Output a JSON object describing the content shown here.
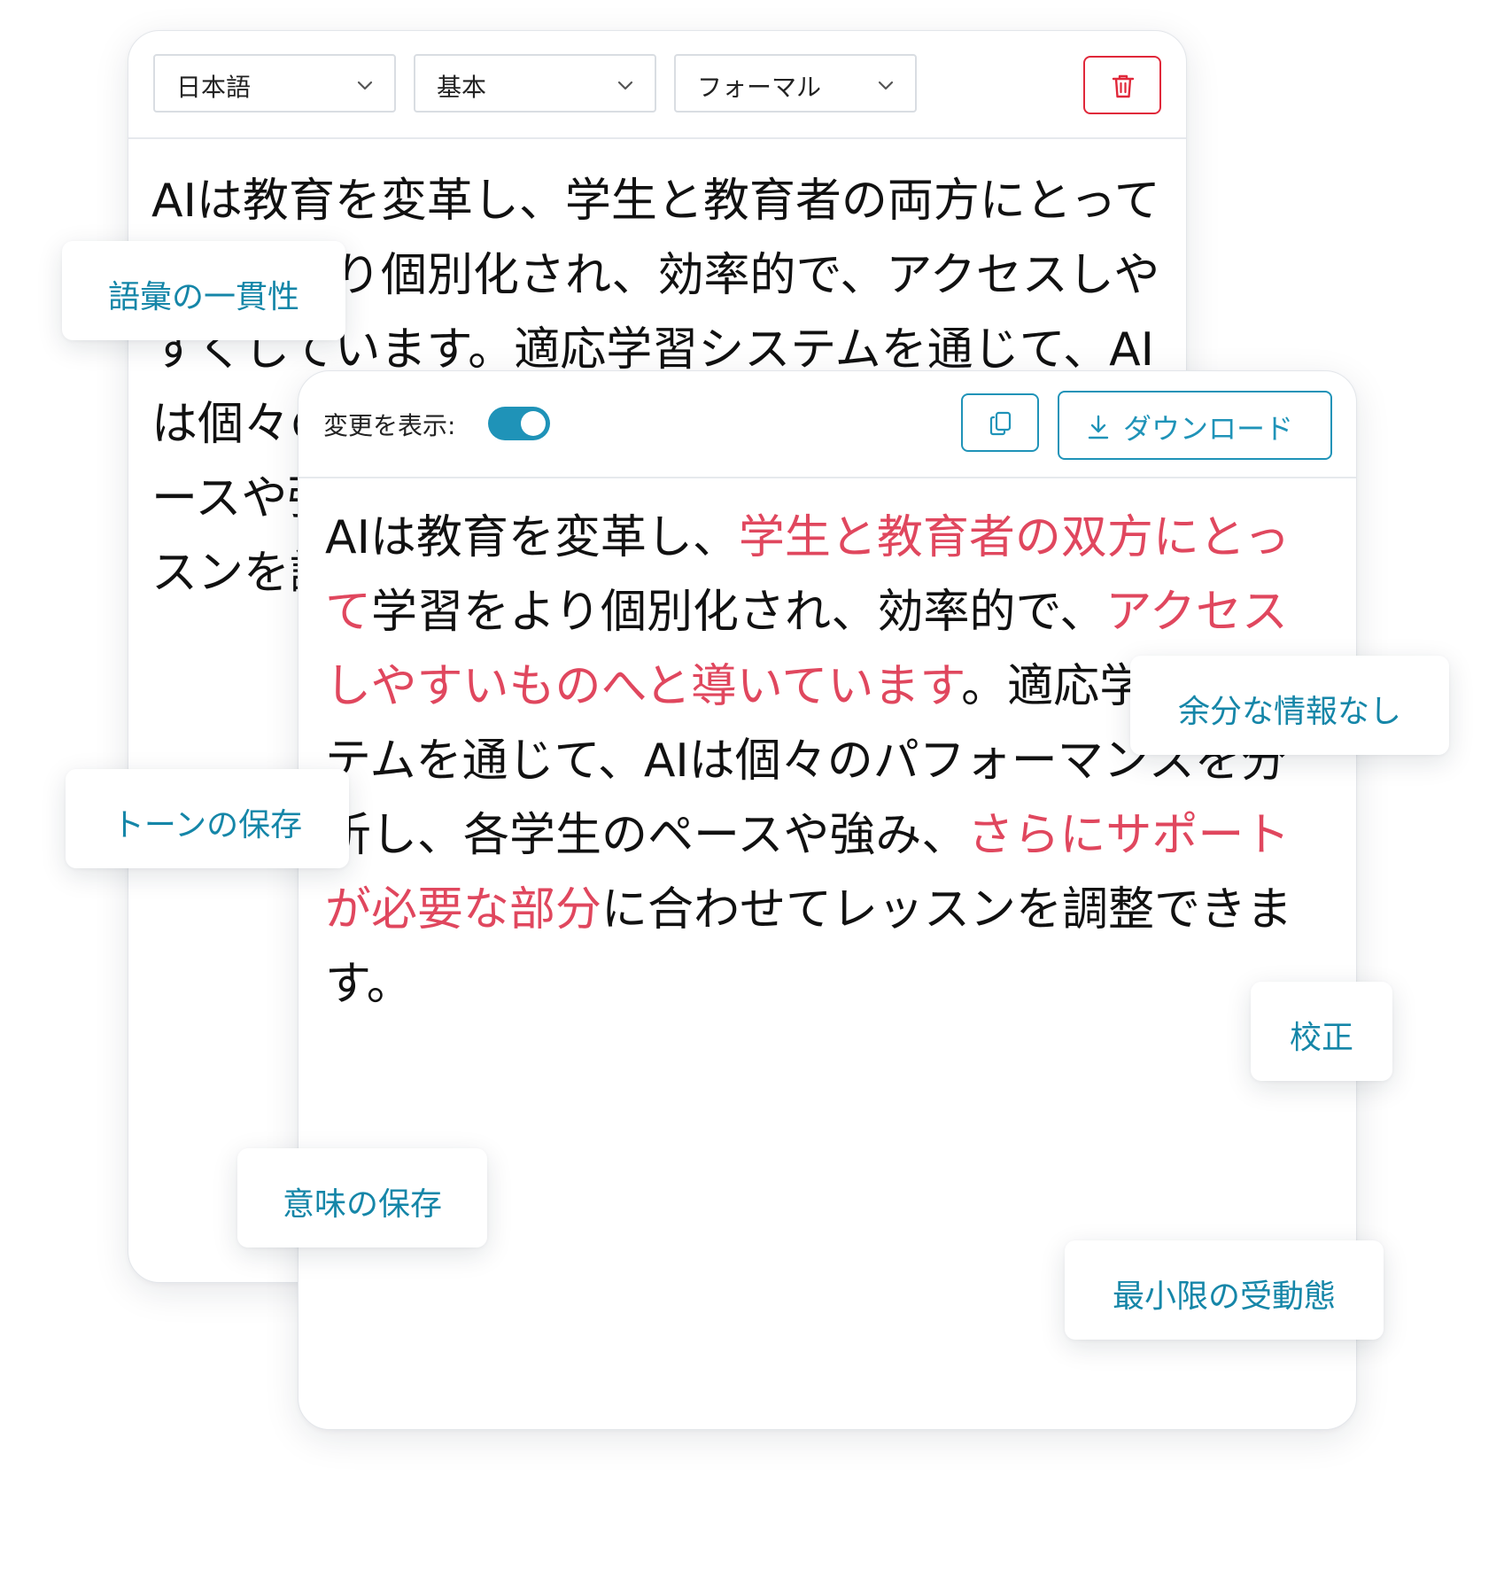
{
  "source_panel": {
    "language_select": "日本語",
    "mode_select": "基本",
    "tone_select": "フォーマル",
    "delete_icon": "trash-icon",
    "text": "AIは教育を変革し、学生と教育者の両方にとって学習をより個別化され、効率的で、アクセスしやすくしています。適応学習システムを通じて、AIは個々のパフォーマンスを分析し、各学生のペースや強み、改善が必要な分野に合わせてレッスンを調整できます。"
  },
  "result_panel": {
    "show_changes_label": "変更を表示:",
    "show_changes_on": true,
    "copy_icon": "copy-icon",
    "download_icon": "download-icon",
    "download_label": "ダウンロード",
    "segments": [
      {
        "text": "AIは教育を変革し、",
        "changed": false
      },
      {
        "text": "学生と教育者の双方にとって",
        "changed": true
      },
      {
        "text": "学習をより個別化され、効率的で、",
        "changed": false
      },
      {
        "text": "アクセスしやすいものへと導いています",
        "changed": true
      },
      {
        "text": "。適応学習システムを通じて、AIは個々のパフォーマンスを分析し、各学生のペースや強み、",
        "changed": false
      },
      {
        "text": "さらにサポートが必要な部分",
        "changed": true
      },
      {
        "text": "に合わせてレッスンを調整できます。",
        "changed": false
      }
    ]
  },
  "features": {
    "vocabulary": "語彙の一貫性",
    "tone": "トーンの保存",
    "no_extra": "余分な情報なし",
    "proofread": "校正",
    "meaning": "意味の保存",
    "passive": "最小限の受動態"
  },
  "colors": {
    "accent": "#1f93b8",
    "change_highlight": "#e0475e",
    "delete": "#e0283a",
    "chip_text": "#1586a8"
  }
}
